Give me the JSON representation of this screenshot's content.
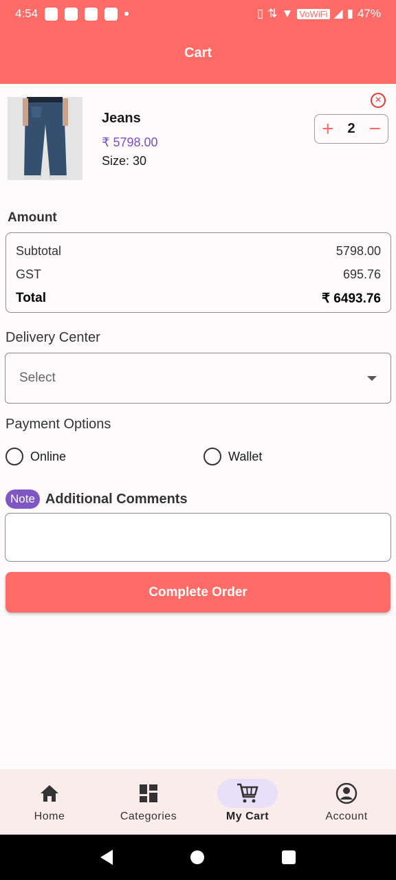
{
  "status_bar": {
    "time": "4:54",
    "network_label": "VoWiFi",
    "battery": "47%"
  },
  "header": {
    "title": "Cart"
  },
  "cart_item": {
    "name": "Jeans",
    "price": "₹ 5798.00",
    "size_label": "Size:",
    "size_value": "30",
    "quantity": "2",
    "plus_symbol": "+",
    "minus_symbol": "−",
    "remove_symbol": "×"
  },
  "amount": {
    "section_title": "Amount",
    "rows": [
      {
        "label": "Subtotal",
        "value": "5798.00"
      },
      {
        "label": "GST",
        "value": "695.76"
      },
      {
        "label": "Total",
        "value": "₹ 6493.76"
      }
    ]
  },
  "delivery": {
    "label": "Delivery Center",
    "selected": "Select"
  },
  "payment": {
    "label": "Payment Options",
    "options": [
      "Online",
      "Wallet"
    ]
  },
  "comments": {
    "badge": "Note",
    "title": "Additional Comments",
    "value": ""
  },
  "actions": {
    "complete_order": "Complete Order"
  },
  "bottom_nav": {
    "items": [
      {
        "label": "Home",
        "icon": "home-icon"
      },
      {
        "label": "Categories",
        "icon": "grid-icon"
      },
      {
        "label": "My Cart",
        "icon": "cart-icon",
        "active": true
      },
      {
        "label": "Account",
        "icon": "account-icon"
      }
    ]
  },
  "colors": {
    "primary": "#ff6b66",
    "price_purple": "#7a4fc0",
    "note_badge": "#7e57c2",
    "active_nav_pill": "#e8e0f8"
  }
}
